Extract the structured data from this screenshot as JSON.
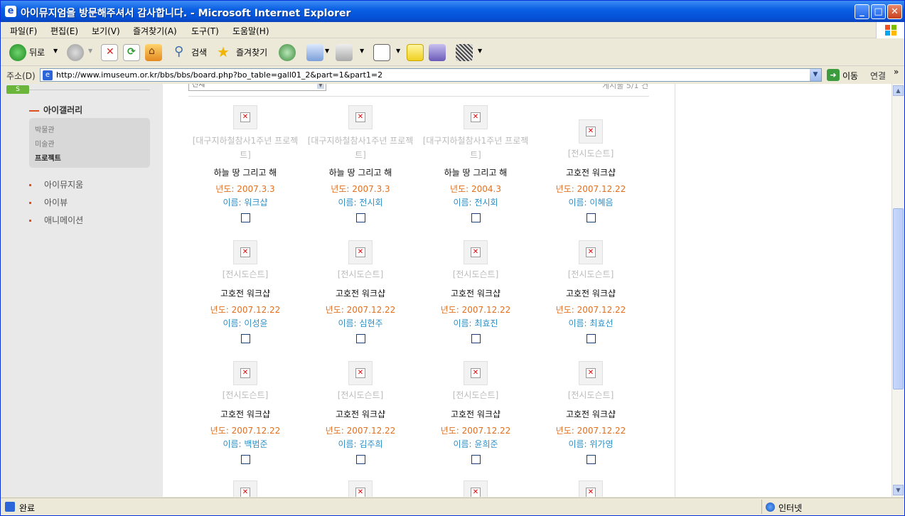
{
  "window": {
    "title": "아이뮤지엄을 방문해주셔서 감사합니다. - Microsoft Internet Explorer",
    "icon": "ie-icon",
    "controls": [
      "minimize-icon",
      "maximize-icon",
      "close-icon"
    ]
  },
  "menubar": {
    "items": [
      "파일(F)",
      "편집(E)",
      "보기(V)",
      "즐겨찾기(A)",
      "도구(T)",
      "도움말(H)"
    ]
  },
  "toolbar": {
    "back_label": "뒤로",
    "search_label": "검색",
    "favorites_label": "즐겨찾기"
  },
  "addressbar": {
    "label": "주소(D)",
    "url": "http://www.imuseum.or.kr/bbs/bbs/board.php?bo_table=gall01_2&part=1&part1=2",
    "go_label": "이동",
    "links_label": "연결",
    "links_more": "»"
  },
  "statusbar": {
    "status": "완료",
    "zone": "인터넷"
  },
  "sidebar": {
    "badge": "S",
    "section_title": "아이갤러리",
    "sub_items": [
      {
        "label": "박물관",
        "active": false
      },
      {
        "label": "미술관",
        "active": false
      },
      {
        "label": "프로젝트",
        "active": true
      }
    ],
    "items": [
      "아이뮤지움",
      "아이뷰",
      "애니메이션"
    ]
  },
  "board": {
    "filter_value": "전체",
    "count_text": "게시물 5/1 건",
    "year_prefix": "년도: ",
    "name_prefix": "이름: ",
    "cards": [
      {
        "category": "[대구지하철참사1주년 프로젝트]",
        "title": "하늘 땅 그리고 해",
        "year": "년도: 2007.3.3",
        "name": "이름: 워크샵"
      },
      {
        "category": "[대구지하철참사1주년 프로젝트]",
        "title": "하늘 땅 그리고 해",
        "year": "년도: 2007.3.3",
        "name": "이름: 전시회"
      },
      {
        "category": "[대구지하철참사1주년 프로젝트]",
        "title": "하늘 땅 그리고 해",
        "year": "년도: 2004.3",
        "name": "이름: 전시회"
      },
      {
        "category": "[전시도슨트]",
        "title": "고호전 워크샵",
        "year": "년도: 2007.12.22",
        "name": "이름: 이혜음"
      },
      {
        "category": "[전시도슨트]",
        "title": "고호전 워크샵",
        "year": "년도: 2007.12.22",
        "name": "이름: 이성윤"
      },
      {
        "category": "[전시도슨트]",
        "title": "고호전 워크샵",
        "year": "년도: 2007.12.22",
        "name": "이름: 심현주"
      },
      {
        "category": "[전시도슨트]",
        "title": "고호전 워크샵",
        "year": "년도: 2007.12.22",
        "name": "이름: 최효진"
      },
      {
        "category": "[전시도슨트]",
        "title": "고호전 워크샵",
        "year": "년도: 2007.12.22",
        "name": "이름: 최효선"
      },
      {
        "category": "[전시도슨트]",
        "title": "고호전 워크샵",
        "year": "년도: 2007.12.22",
        "name": "이름: 백범준"
      },
      {
        "category": "[전시도슨트]",
        "title": "고호전 워크샵",
        "year": "년도: 2007.12.22",
        "name": "이름: 김주희"
      },
      {
        "category": "[전시도슨트]",
        "title": "고호전 워크샵",
        "year": "년도: 2007.12.22",
        "name": "이름: 윤희준"
      },
      {
        "category": "[전시도슨트]",
        "title": "고호전 워크샵",
        "year": "년도: 2007.12.22",
        "name": "이름: 위가영"
      }
    ]
  },
  "colors": {
    "title_bar": "#0a5fe2",
    "year_text": "#e07020",
    "name_text": "#2b8fc7",
    "category_text": "#bbbbbb",
    "accent_dash": "#e0501e"
  }
}
